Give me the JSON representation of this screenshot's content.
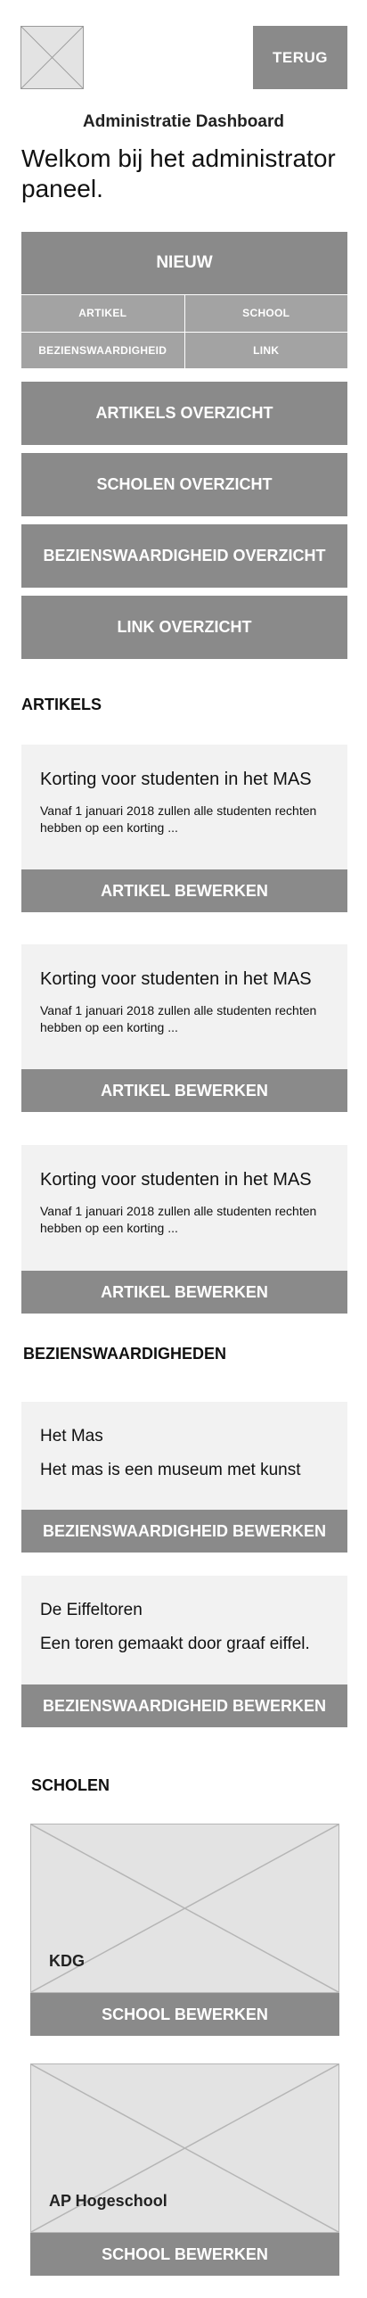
{
  "header": {
    "logo_icon": "placeholder-image-icon",
    "back_label": "TERUG"
  },
  "dashboard_title": "Administratie Dashboard",
  "welcome_text": "Welkom bij het administrator paneel.",
  "new_menu": {
    "label": "NIEUW",
    "items": [
      "ARTIKEL",
      "SCHOOL",
      "BEZIENSWAARDIGHEID",
      "LINK"
    ]
  },
  "overviews": [
    "ARTIKELS OVERZICHT",
    "SCHOLEN OVERZICHT",
    "BEZIENSWAARDIGHEID OVERZICHT",
    "LINK OVERZICHT"
  ],
  "articles": {
    "heading": "ARTIKELS",
    "items": [
      {
        "title": "Korting voor studenten in het MAS",
        "excerpt": "Vanaf 1 januari 2018 zullen alle studenten rechten hebben op een korting ...",
        "button": "ARTIKEL BEWERKEN"
      },
      {
        "title": "Korting voor studenten in het MAS",
        "excerpt": "Vanaf 1 januari 2018 zullen alle studenten rechten hebben op een korting ...",
        "button": "ARTIKEL BEWERKEN"
      },
      {
        "title": "Korting voor studenten in het MAS",
        "excerpt": "Vanaf 1 januari 2018 zullen alle studenten rechten hebben op een korting ...",
        "button": "ARTIKEL BEWERKEN"
      }
    ]
  },
  "sights": {
    "heading": "BEZIENSWAARDIGHEDEN",
    "items": [
      {
        "title": "Het Mas",
        "description": "Het mas is een museum met kunst",
        "button": "BEZIENSWAARDIGHEID BEWERKEN"
      },
      {
        "title": "De Eiffeltoren",
        "description": "Een toren gemaakt door graaf eiffel.",
        "button": "BEZIENSWAARDIGHEID BEWERKEN"
      }
    ]
  },
  "schools": {
    "heading": "SCHOLEN",
    "items": [
      {
        "name": "KDG",
        "image_icon": "placeholder-image-icon",
        "button": "SCHOOL BEWERKEN"
      },
      {
        "name": "AP Hogeschool",
        "image_icon": "placeholder-image-icon",
        "button": "SCHOOL BEWERKEN"
      }
    ]
  },
  "colors": {
    "button_gray": "#8a8a8a",
    "submenu_gray": "#a3a3a3",
    "card_bg": "#f2f2f2",
    "placeholder_bg": "#e3e3e3"
  }
}
